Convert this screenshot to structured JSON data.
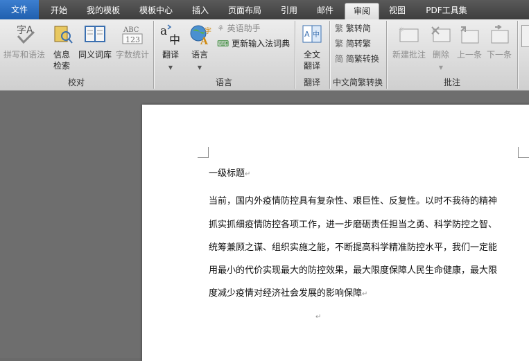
{
  "tabs": [
    {
      "label": "文件",
      "key": "file"
    },
    {
      "label": "开始"
    },
    {
      "label": "我的模板"
    },
    {
      "label": "模板中心"
    },
    {
      "label": "插入"
    },
    {
      "label": "页面布局"
    },
    {
      "label": "引用"
    },
    {
      "label": "邮件"
    },
    {
      "label": "审阅",
      "active": true
    },
    {
      "label": "视图"
    },
    {
      "label": "PDF工具集"
    }
  ],
  "ribbon": {
    "proofing": {
      "spelling": "拼写和语法",
      "research_line1": "信息",
      "research_line2": "检索",
      "thesaurus": "同义词库",
      "wordcount": "字数统计",
      "group": "校对"
    },
    "language": {
      "translate": "翻译",
      "language": "语言",
      "english_assistant": "英语助手",
      "update_ime": "更新输入法词典",
      "group": "语言"
    },
    "translation": {
      "full_line1": "全文",
      "full_line2": "翻译",
      "group": "翻译"
    },
    "chinese": {
      "trad_to_simp": "繁转简",
      "simp_to_trad": "简转繁",
      "convert": "简繁转换",
      "group": "中文简繁转换"
    },
    "comments": {
      "new": "新建批注",
      "delete": "删除",
      "prev": "上一条",
      "next": "下一条",
      "group": "批注"
    }
  },
  "document": {
    "heading": "一级标题",
    "lines": [
      "当前，国内外疫情防控具有复杂性、艰巨性、反复性。以时不我待的精神",
      "抓实抓细疫情防控各项工作，进一步磨砺责任担当之勇、科学防控之智、",
      "统筹兼顾之谋、组织实施之能，不断提高科学精准防控水平，我们一定能",
      "用最小的代价实现最大的防控效果，最大限度保障人民生命健康，最大限",
      "度减少疫情对经济社会发展的影响保障"
    ],
    "para_mark": "↵"
  },
  "colors": {
    "file_tab": "#2a6cc0",
    "tabbar": "#4a4a4a",
    "ribbon": "#e3e3e3"
  }
}
